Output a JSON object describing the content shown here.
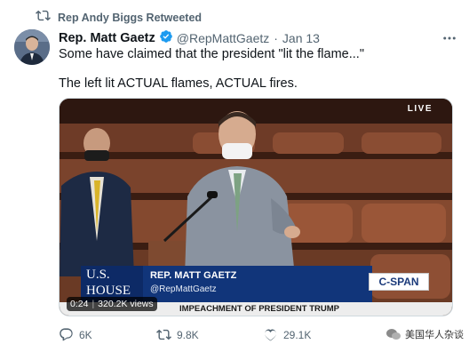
{
  "retweet": {
    "text": "Rep Andy Biggs Retweeted",
    "icon": "retweet-icon"
  },
  "author": {
    "display_name": "Rep. Matt Gaetz",
    "handle": "@RepMattGaetz",
    "separator": "·",
    "date": "Jan 13",
    "verified_icon": "verified-badge-icon",
    "verified_color": "#1d9bf0"
  },
  "tweet": {
    "line1": "Some have claimed that the president \"lit the flame...\"",
    "line2": "The left lit ACTUAL flames, ACTUAL fires."
  },
  "video": {
    "live_label": "LIVE",
    "logo_line1": "U.S.",
    "logo_line2": "HOUSE",
    "chyron_name": "REP. MATT GAETZ",
    "chyron_handle": "@RepMattGaetz",
    "network": "C-SPAN",
    "subtitle": "IMPEACHMENT OF PRESIDENT TRUMP",
    "time": "0:24",
    "views": "320.2K views"
  },
  "actions": {
    "reply_count": "6K",
    "retweet_count": "9.8K",
    "like_count": "29.1K"
  },
  "watermark": {
    "text": "美国华人杂谈"
  },
  "colors": {
    "text_primary": "#0f1419",
    "text_secondary": "#536471",
    "chyron_blue": "#11357a"
  }
}
